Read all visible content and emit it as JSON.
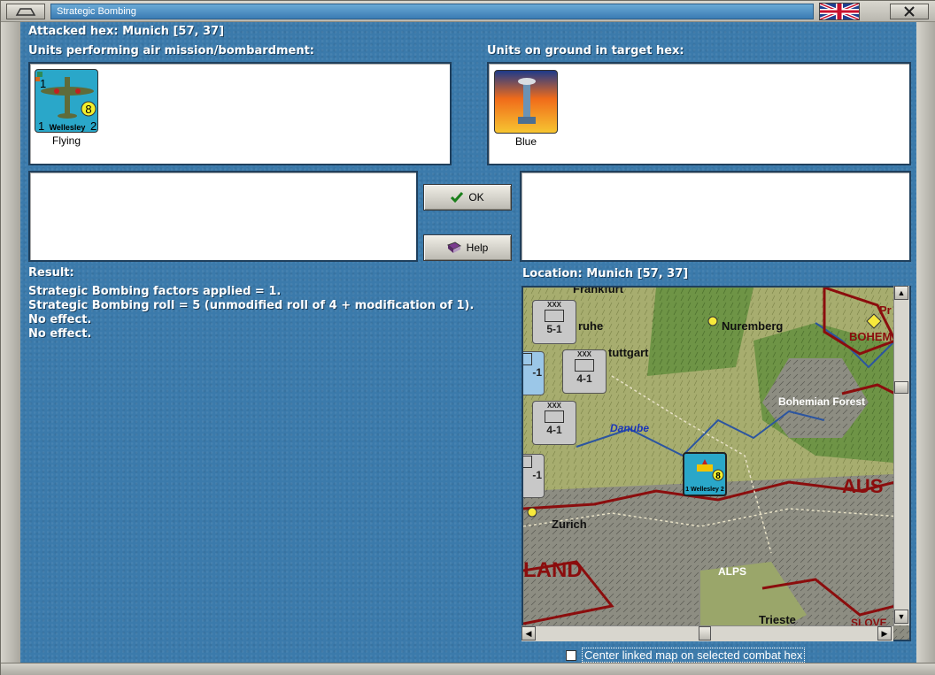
{
  "window": {
    "title": "Strategic Bombing"
  },
  "header": {
    "attacked_hex": "Attacked hex: Munich  [57, 37]"
  },
  "attackers": {
    "label": "Units performing air mission/bombardment:",
    "units": [
      {
        "name": "Wellesley",
        "caption": "Flying",
        "strength": "8",
        "left": "1",
        "right": "2",
        "top": "1",
        "color": "#2aa7c9"
      }
    ]
  },
  "defenders": {
    "label": "Units on ground in target hex:",
    "units": [
      {
        "caption": "Blue",
        "color": "#3a6fc4"
      }
    ]
  },
  "buttons": {
    "ok": "OK",
    "help": "Help"
  },
  "result": {
    "label": "Result:",
    "lines": [
      "Strategic Bombing factors applied = 1.",
      "Strategic Bombing roll = 5 (unmodified roll of 4 + modification of 1).",
      "No effect.",
      "No effect."
    ]
  },
  "location": {
    "label": "Location:  Munich  [57, 37]"
  },
  "map": {
    "places": [
      "Frankfurt",
      "ruhe",
      "tuttgart",
      "Nuremberg",
      "Bohemian Forest",
      "Danube",
      "Zurich",
      "ALPS",
      "Trieste",
      "AUS",
      "LAND",
      "BOHEM",
      "SLOVE",
      "Pr"
    ],
    "counters": [
      {
        "side": "XXX",
        "value": "5-1"
      },
      {
        "side": "XXX",
        "value": "4-1"
      },
      {
        "side": "XXX",
        "value": "4-1"
      },
      {
        "side": "",
        "value": "-1"
      },
      {
        "side": "",
        "value": "-1"
      }
    ],
    "unit_on_map": {
      "name": "1 Wellesley 2",
      "strength": "8"
    }
  },
  "footer": {
    "center_checkbox": "Center linked map on selected combat hex",
    "checked": false
  },
  "colors": {
    "background": "#3b7aab",
    "frame": "#c9c7bf",
    "border_red": "#8b0d0d"
  },
  "icons": [
    "minimize-icon",
    "close-icon",
    "checkmark-icon",
    "help-book-icon",
    "uk-flag-icon"
  ]
}
